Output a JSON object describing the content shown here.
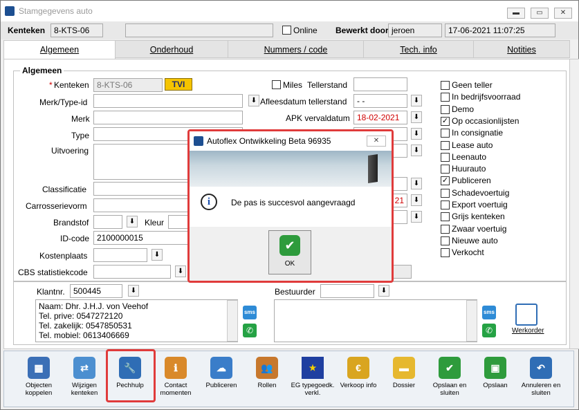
{
  "window": {
    "title": "Stamgegevens auto",
    "min": "▬",
    "max": "▭",
    "close": "✕"
  },
  "header": {
    "kenteken_label": "Kenteken",
    "kenteken_value": "8-KTS-06",
    "online_label": "Online",
    "bewerkt_label": "Bewerkt door",
    "bewerkt_value": "jeroen",
    "datetime": "17-06-2021 11:07:25"
  },
  "tabs": [
    "Algemeen",
    "Onderhoud",
    "Nummers / code",
    "Tech. info",
    "Notities"
  ],
  "algemeen": {
    "group_title": "Algemeen",
    "required_mark": "*",
    "kenteken_label": "Kenteken",
    "kenteken_value": "8-KTS-06",
    "tvi": "TVI",
    "merk_type_id_label": "Merk/Type-id",
    "merk_label": "Merk",
    "type_label": "Type",
    "uitvoering_label": "Uitvoering",
    "classificatie_label": "Classificatie",
    "carrosserie_label": "Carrosserievorm",
    "brandstof_label": "Brandstof",
    "kleur_label": "Kleur",
    "id_code_label": "ID-code",
    "id_code_value": "2100000015",
    "kostenplaats_label": "Kostenplaats",
    "cbs_label": "CBS statistiekcode",
    "miles_label": "Miles",
    "tellerstand_label": "Tellerstand",
    "afleesdatum_label": "Afleesdatum tellerstand",
    "afleesdatum_value": "-  -",
    "apk_label": "APK vervaldatum",
    "apk_value": "18-02-2021",
    "partial_red": "21"
  },
  "checks": [
    {
      "label": "Geen teller",
      "checked": false
    },
    {
      "label": "In bedrijfsvoorraad",
      "checked": false
    },
    {
      "label": "Demo",
      "checked": false
    },
    {
      "label": "Op occasionlijsten",
      "checked": true
    },
    {
      "label": "In consignatie",
      "checked": false
    },
    {
      "label": "Lease auto",
      "checked": false
    },
    {
      "label": "Leenauto",
      "checked": false
    },
    {
      "label": "Huurauto",
      "checked": false
    },
    {
      "label": "Publiceren",
      "checked": true
    },
    {
      "label": "Schadevoertuig",
      "checked": false
    },
    {
      "label": "Export voertuig",
      "checked": false
    },
    {
      "label": "Grijs kenteken",
      "checked": false
    },
    {
      "label": "Zwaar voertuig",
      "checked": false
    },
    {
      "label": "Nieuwe auto",
      "checked": false
    },
    {
      "label": "Verkocht",
      "checked": false
    }
  ],
  "klant": {
    "label": "Klantnr.",
    "value": "500445",
    "lines": [
      "Naam: Dhr. J.H.J. von Veehof",
      "Tel. prive: 0547272120",
      "Tel. zakelijk: 0547850531",
      "Tel. mobiel: 0613406669"
    ],
    "sms": "sms"
  },
  "bestuurder": {
    "label": "Bestuurder"
  },
  "werkorder": {
    "label": "Werkorder"
  },
  "toolbar": [
    {
      "label": "Objecten koppelen",
      "icon": "objects-icon",
      "color": "#3b6fb6"
    },
    {
      "label": "Wijzigen kenteken",
      "icon": "change-plate-icon",
      "color": "#4c8fd0"
    },
    {
      "label": "Pechhulp",
      "icon": "wrench-icon",
      "color": "#2f6db5"
    },
    {
      "label": "Contact momenten",
      "icon": "contact-icon",
      "color": "#d9892a"
    },
    {
      "label": "Publiceren",
      "icon": "cloud-icon",
      "color": "#3a7dc9"
    },
    {
      "label": "Rollen",
      "icon": "people-icon",
      "color": "#c7782d"
    },
    {
      "label": "EG typegoedk. verkl.",
      "icon": "eu-flag-icon",
      "color": "#1f3fa0"
    },
    {
      "label": "Verkoop info",
      "icon": "euro-icon",
      "color": "#d9a520"
    },
    {
      "label": "Dossier",
      "icon": "folder-icon",
      "color": "#e6b82f"
    },
    {
      "label": "Opslaan en sluiten",
      "icon": "check-icon",
      "color": "#2e9b3c"
    },
    {
      "label": "Opslaan",
      "icon": "save-icon",
      "color": "#2e9b3c"
    },
    {
      "label": "Annuleren en sluiten",
      "icon": "undo-icon",
      "color": "#2f6db5"
    }
  ],
  "dialog": {
    "title": "Autoflex Ontwikkeling Beta 96935",
    "close": "✕",
    "message": "De pas is succesvol aangevraagd",
    "ok": "OK",
    "info": "i"
  }
}
